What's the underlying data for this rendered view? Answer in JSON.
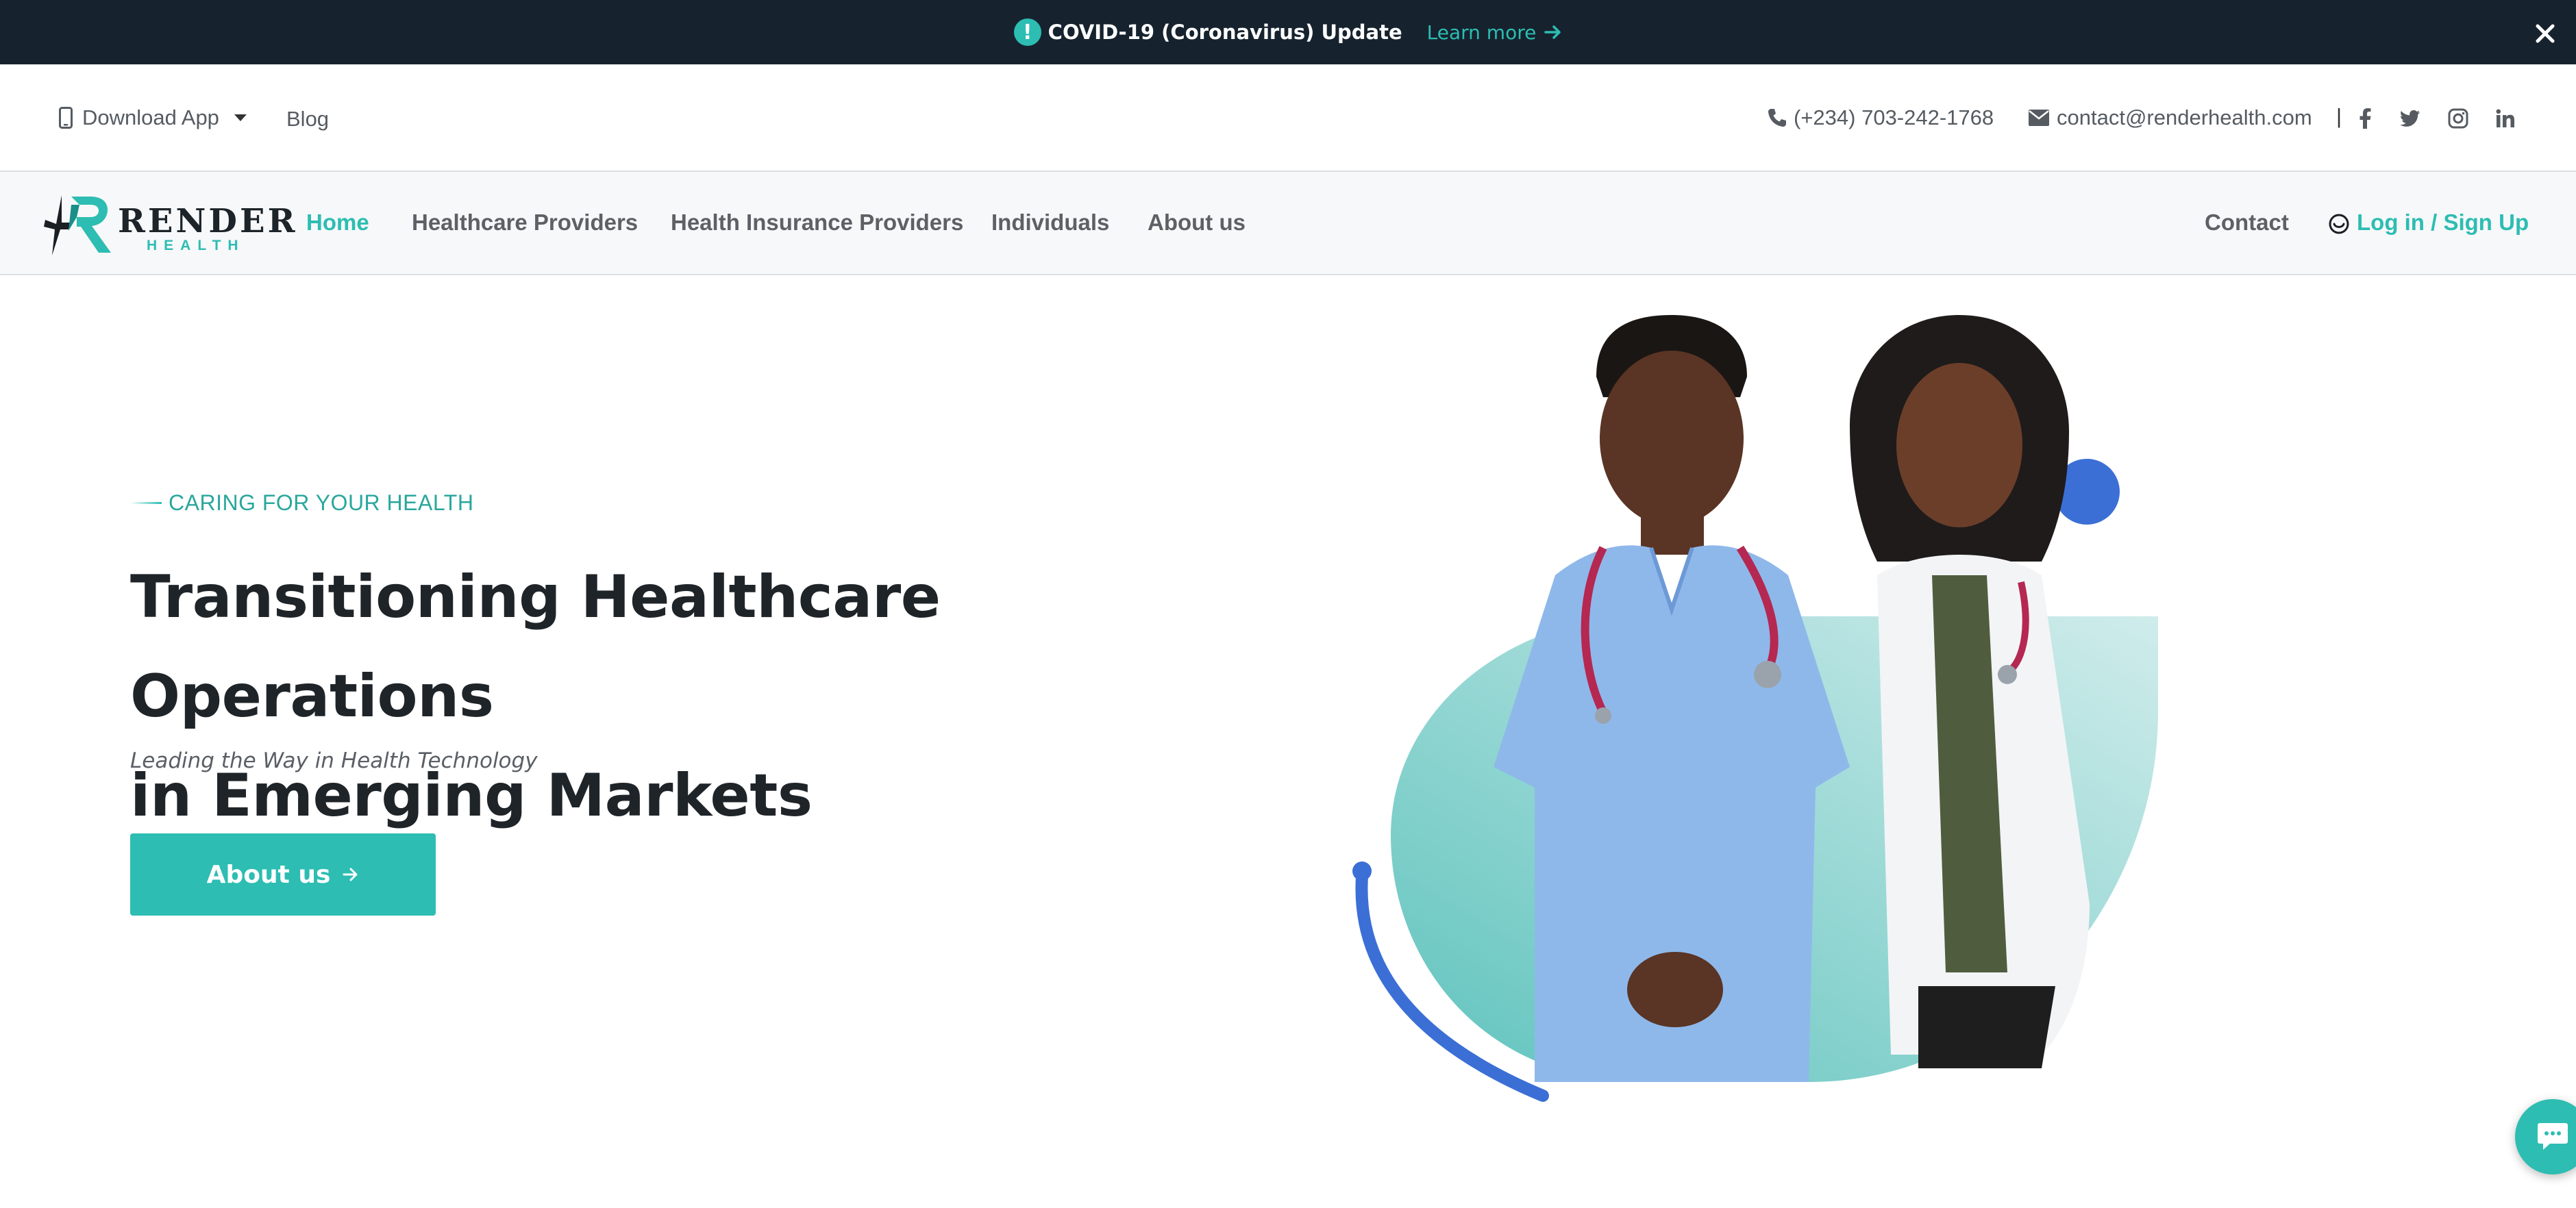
{
  "covid_banner": {
    "title": "COVID-19 (Coronavirus) Update",
    "link_label": "Learn more",
    "icon": "exclamation-icon",
    "close_icon": "close-icon"
  },
  "top_bar": {
    "download_app_label": "Download App",
    "blog_label": "Blog",
    "phone": "(+234) 703-242-1768",
    "email": "contact@renderhealth.com",
    "divider": "|",
    "social_icons": [
      "facebook-icon",
      "twitter-icon",
      "instagram-icon",
      "linkedin-icon"
    ]
  },
  "nav": {
    "logo_text": "RENDER",
    "logo_subtext": "HEALTH",
    "items": [
      {
        "label": "Home",
        "active": true
      },
      {
        "label": "Healthcare Providers",
        "active": false
      },
      {
        "label": "Health Insurance Providers",
        "active": false
      },
      {
        "label": "Individuals",
        "active": false
      },
      {
        "label": "About us",
        "active": false
      }
    ],
    "contact_label": "Contact",
    "login_label": "Log in / Sign Up"
  },
  "hero": {
    "eyebrow": "CARING FOR YOUR HEALTH",
    "title_line1": "Transitioning Healthcare Operations",
    "title_line2": "in Emerging Markets",
    "subtitle": "Leading the Way in Health Technology",
    "button_label": "About us"
  },
  "colors": {
    "accent": "#2dbdb2",
    "banner_bg": "#16232f",
    "decor_blue": "#3b6fd6",
    "heading": "#1f2429"
  },
  "chat": {
    "icon": "chat-bubble-icon"
  }
}
